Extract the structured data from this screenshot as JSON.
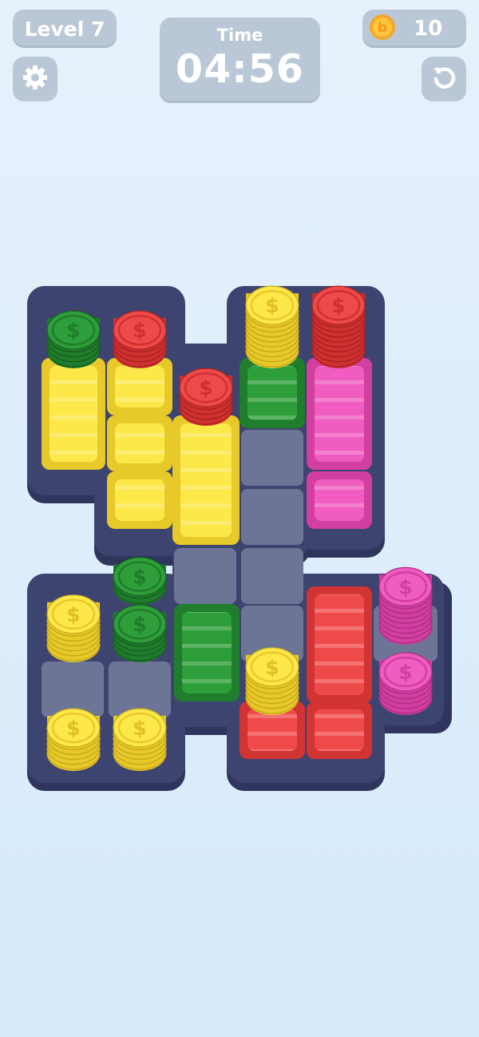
{
  "hud": {
    "level_label": "Level 7",
    "time_label": "Time",
    "time_value": "04:56",
    "coins": "10"
  },
  "icons": {
    "settings": "gear-icon",
    "undo": "undo-icon",
    "currency": "coin-icon",
    "coin_face": "dollar-sign"
  },
  "colors": {
    "green": "#2e9e3a",
    "red": "#ef4a4a",
    "yellow": "#fde84a",
    "pink": "#f05cbf",
    "board": "#3e4470",
    "board_cell": "#6d7596"
  },
  "board": {
    "coin_stacks": [
      {
        "color": "green",
        "count": 5
      },
      {
        "color": "red",
        "count": 5
      },
      {
        "color": "yellow",
        "count": 10
      },
      {
        "color": "red",
        "count": 10
      },
      {
        "color": "red",
        "count": 5
      },
      {
        "color": "green",
        "count": 3
      },
      {
        "color": "green",
        "count": 5
      },
      {
        "color": "yellow",
        "count": 7
      },
      {
        "color": "yellow",
        "count": 7
      },
      {
        "color": "pink",
        "count": 9
      },
      {
        "color": "yellow",
        "count": 6
      },
      {
        "color": "pink",
        "count": 6
      },
      {
        "color": "yellow",
        "count": 6
      }
    ],
    "containers": [
      {
        "color": "yellow"
      },
      {
        "color": "yellow"
      },
      {
        "color": "yellow"
      },
      {
        "color": "yellow"
      },
      {
        "color": "yellow"
      },
      {
        "color": "green"
      },
      {
        "color": "pink"
      },
      {
        "color": "pink"
      },
      {
        "color": "green"
      },
      {
        "color": "red"
      },
      {
        "color": "red"
      },
      {
        "color": "red"
      }
    ]
  }
}
